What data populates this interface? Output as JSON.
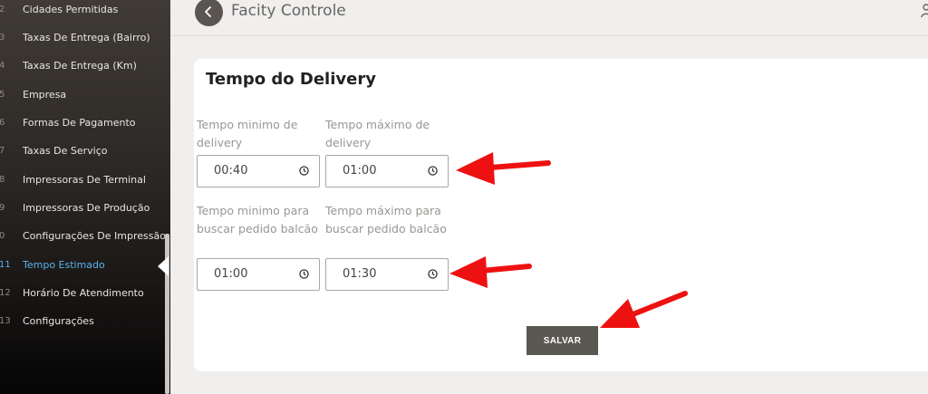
{
  "sidebar": {
    "items": [
      {
        "num": "2",
        "label": "Cidades Permitidas"
      },
      {
        "num": "3",
        "label": "Taxas De Entrega (Bairro)"
      },
      {
        "num": "4",
        "label": "Taxas De Entrega (Km)"
      },
      {
        "num": "5",
        "label": "Empresa"
      },
      {
        "num": "6",
        "label": "Formas De Pagamento"
      },
      {
        "num": "7",
        "label": "Taxas De Serviço"
      },
      {
        "num": "8",
        "label": "Impressoras De Terminal"
      },
      {
        "num": "9",
        "label": "Impressoras De Produção"
      },
      {
        "num": "0",
        "label": "Configurações De Impressão"
      },
      {
        "num": "11",
        "label": "Tempo Estimado"
      },
      {
        "num": "12",
        "label": "Horário De Atendimento"
      },
      {
        "num": "13",
        "label": "Configurações"
      }
    ],
    "active_index": 9
  },
  "header": {
    "title": "Facity Controle"
  },
  "card": {
    "title": "Tempo do Delivery",
    "fields": {
      "delivery_min": {
        "label": "Tempo minimo de delivery",
        "value": "00:40"
      },
      "delivery_max": {
        "label": "Tempo máximo de delivery",
        "value": "01:00"
      },
      "pickup_min": {
        "label": "Tempo minimo para buscar pedido balcão",
        "value": "01:00"
      },
      "pickup_max": {
        "label": "Tempo máximo para buscar pedido balcão",
        "value": "01:30"
      }
    },
    "save_label": "SALVAR"
  },
  "colors": {
    "active_item": "#5ab4ef",
    "button": "#5b5751",
    "annotation_arrow": "#ee1111"
  }
}
